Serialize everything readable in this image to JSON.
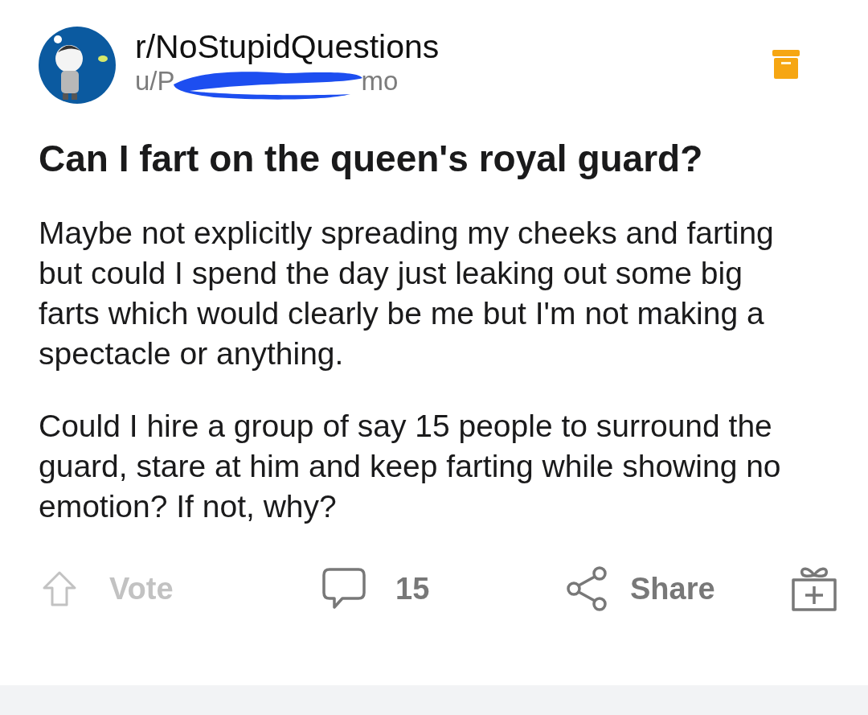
{
  "post": {
    "subreddit": "r/NoStupidQuestions",
    "author_start": "u/P",
    "author_end": "mo",
    "author_redacted": true,
    "archived": true,
    "title": "Can I fart on the queen's royal guard?",
    "paragraphs": [
      "Maybe not explicitly spreading my cheeks and farting but could I spend the day just leaking out some big farts which would clearly be me but I'm not making a spectacle or anything.",
      "Could I hire a group of say 15 people to surround the guard, stare at him and keep farting while showing no emotion? If not, why?"
    ]
  },
  "actions": [
    {
      "kind": "vote",
      "label": "Vote",
      "disabled": true
    },
    {
      "kind": "comments",
      "label": "15",
      "disabled": false
    },
    {
      "kind": "share",
      "label": "Share",
      "disabled": false
    },
    {
      "kind": "award",
      "disabled": false
    }
  ]
}
